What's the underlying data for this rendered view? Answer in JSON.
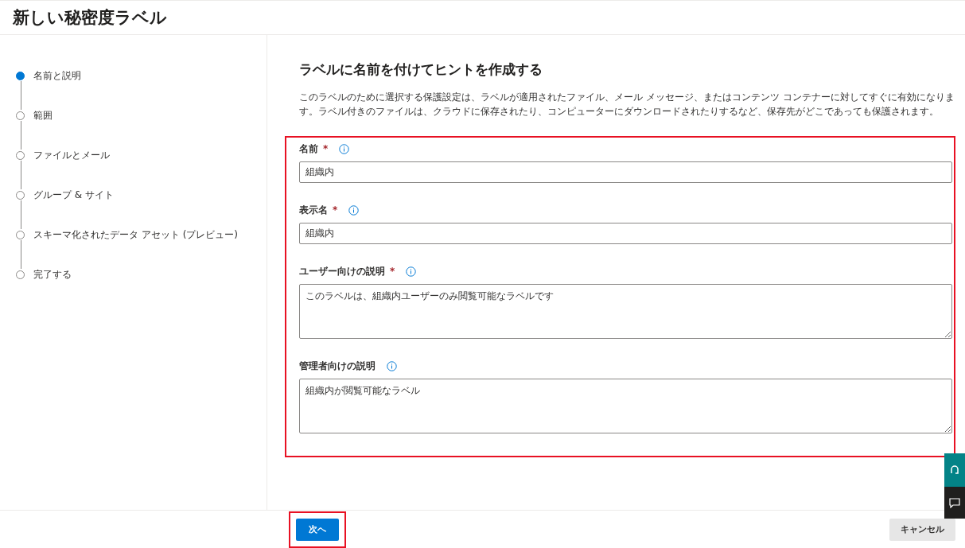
{
  "page": {
    "title": "新しい秘密度ラベル"
  },
  "steps": [
    {
      "label": "名前と説明",
      "selected": true
    },
    {
      "label": "範囲",
      "selected": false
    },
    {
      "label": "ファイルとメール",
      "selected": false
    },
    {
      "label": "グループ & サイト",
      "selected": false
    },
    {
      "label": "スキーマ化されたデータ アセット (プレビュー)",
      "selected": false
    },
    {
      "label": "完了する",
      "selected": false
    }
  ],
  "content": {
    "heading": "ラベルに名前を付けてヒントを作成する",
    "description": "このラベルのために選択する保護設定は、ラベルが適用されたファイル、メール メッセージ、またはコンテンツ コンテナーに対してすぐに有効になります。ラベル付きのファイルは、クラウドに保存されたり、コンピューターにダウンロードされたりするなど、保存先がどこであっても保護されます。"
  },
  "fields": [
    {
      "label": "名前",
      "required_mark": "*",
      "kind": "input",
      "value": "組織内"
    },
    {
      "label": "表示名",
      "required_mark": "*",
      "kind": "input",
      "value": "組織内"
    },
    {
      "label": "ユーザー向けの説明",
      "required_mark": "*",
      "kind": "textarea",
      "value": "このラベルは、組織内ユーザーのみ閲覧可能なラベルです"
    },
    {
      "label": "管理者向けの説明",
      "kind": "textarea",
      "value": "組織内が閲覧可能なラベル"
    }
  ],
  "footer": {
    "next_button": "次へ",
    "cancel_button": "キャンセル"
  }
}
